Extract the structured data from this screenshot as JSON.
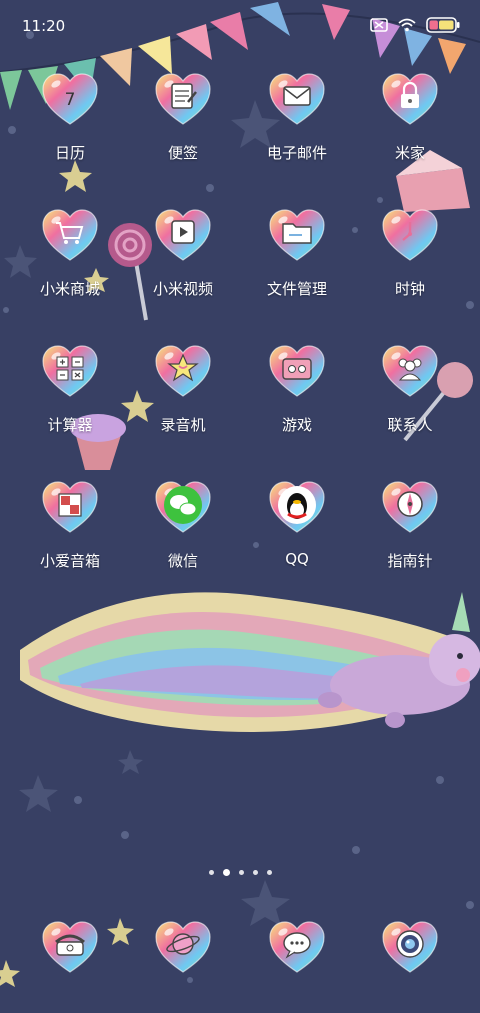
{
  "status_bar": {
    "time": "11:20",
    "icons": [
      "sim-blocked-icon",
      "wifi-icon",
      "battery-icon"
    ],
    "battery_level": 0.35
  },
  "apps": [
    {
      "label": "日历",
      "icon": "calendar-icon",
      "badge": "7"
    },
    {
      "label": "便签",
      "icon": "notes-icon"
    },
    {
      "label": "电子邮件",
      "icon": "mail-icon"
    },
    {
      "label": "米家",
      "icon": "mijia-lock-icon"
    },
    {
      "label": "小米商城",
      "icon": "shopping-cart-icon"
    },
    {
      "label": "小米视频",
      "icon": "video-play-icon"
    },
    {
      "label": "文件管理",
      "icon": "folder-icon"
    },
    {
      "label": "时钟",
      "icon": "clock-icon"
    },
    {
      "label": "计算器",
      "icon": "calculator-icon"
    },
    {
      "label": "录音机",
      "icon": "recorder-icon"
    },
    {
      "label": "游戏",
      "icon": "game-cassette-icon"
    },
    {
      "label": "联系人",
      "icon": "contacts-icon"
    },
    {
      "label": "小爱音箱",
      "icon": "xiaoai-speaker-icon"
    },
    {
      "label": "微信",
      "icon": "wechat-icon"
    },
    {
      "label": "QQ",
      "icon": "qq-penguin-icon"
    },
    {
      "label": "指南针",
      "icon": "compass-icon"
    }
  ],
  "dock": [
    {
      "icon": "phone-icon"
    },
    {
      "icon": "browser-planet-icon"
    },
    {
      "icon": "messages-icon"
    },
    {
      "icon": "camera-icon"
    }
  ],
  "pager": {
    "pages": 5,
    "current": 2
  },
  "colors": {
    "background": "#384064",
    "heart_pink": "#f06fa0",
    "heart_blue": "#6ec9f2",
    "heart_yellow": "#f7e67c",
    "heart_green": "#8fe0a8"
  }
}
